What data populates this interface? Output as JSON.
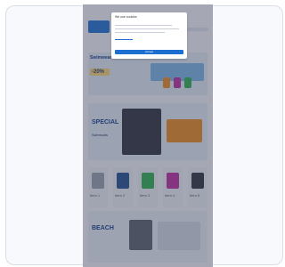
{
  "modal": {
    "title": "We use cookies",
    "accept_label": "Accept"
  },
  "hero1": {
    "headline": "Swimwear",
    "badge": "-20%"
  },
  "hero2": {
    "headline": "SPECIAL",
    "subline": "Swimsuits"
  },
  "products": [
    {
      "name": "Item 1"
    },
    {
      "name": "Item 2"
    },
    {
      "name": "Item 3"
    },
    {
      "name": "Item 4"
    },
    {
      "name": "Item 5"
    }
  ],
  "hero3": {
    "headline": "BEACH"
  },
  "colors": {
    "accent": "#1c6fd1",
    "orange": "#f08a18",
    "magenta": "#c1289d",
    "green": "#2bb14b"
  }
}
